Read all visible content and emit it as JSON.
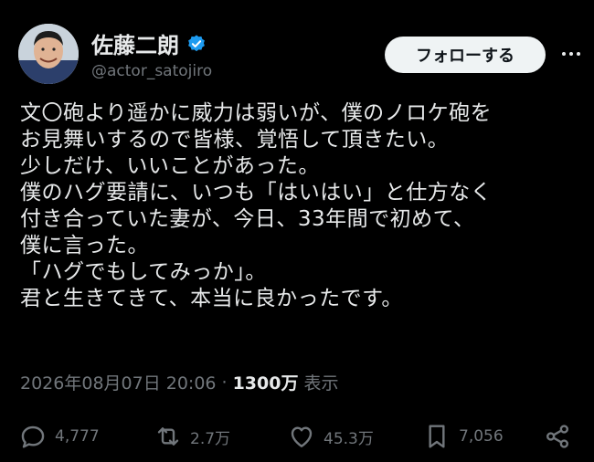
{
  "author": {
    "display_name": "佐藤二朗",
    "handle": "@actor_satojiro",
    "verified": true
  },
  "follow_label": "フォローする",
  "tweet_lines": [
    "文〇砲より遥かに威力は弱いが、僕のノロケ砲を",
    "お見舞いするので皆様、覚悟して頂きたい。",
    "少しだけ、いいことがあった。",
    "僕のハグ要請に、いつも「はいはい」と仕方なく",
    "付き合っていた妻が、今日、33年間で初めて、",
    "僕に言った。",
    "「ハグでもしてみっか」。",
    "君と生きてきて、本当に良かったです。"
  ],
  "meta": {
    "timestamp": "2026年08月07日 20:06",
    "separator": "·",
    "views_count": "1300万",
    "views_label": "表示"
  },
  "actions": {
    "replies": "4,777",
    "retweets": "2.7万",
    "likes": "45.3万",
    "bookmarks": "7,056"
  },
  "colors": {
    "background": "#000000",
    "text": "#e7e9ea",
    "muted": "#71767b",
    "verified_blue": "#1d9bf0",
    "follow_bg": "#eff3f4"
  },
  "icons": [
    "verified-badge-icon",
    "more-icon",
    "reply-icon",
    "retweet-icon",
    "like-icon",
    "bookmark-icon",
    "share-icon"
  ]
}
